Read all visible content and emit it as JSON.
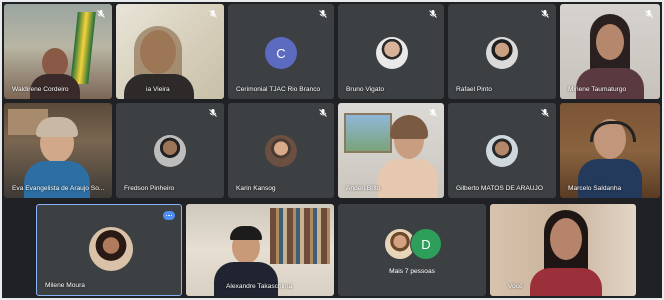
{
  "participants": [
    {
      "name": "Waldirene Cordeiro"
    },
    {
      "name": "ia Vieira"
    },
    {
      "name": "Cerimonial TJAC Rio Branco",
      "initial": "C"
    },
    {
      "name": "Bruno Vigato"
    },
    {
      "name": "Rafael Pinto"
    },
    {
      "name": "Miriene Taumaturgo"
    },
    {
      "name": "Eva Evangelista de Araujo So..."
    },
    {
      "name": "Fredson Pinheiro"
    },
    {
      "name": "Karin Kansog"
    },
    {
      "name": "Anderi Brito"
    },
    {
      "name": "Gilberto MATOS DE ARAUJO"
    },
    {
      "name": "Marcelo Saldanha"
    },
    {
      "name": "Milene Moura"
    },
    {
      "name": "Alexandre Takaschima"
    },
    {
      "name": "Mais 7 pessoas",
      "initial": "D"
    },
    {
      "name": "Você"
    }
  ],
  "colors": {
    "tile_bg": "#3c4043",
    "accent_blue": "#4f8ef7",
    "cerimonial_avatar": "#5c6bc0",
    "more_people_avatar": "#2e9e5b"
  },
  "icons": {
    "muted": "mic-off-icon",
    "pinned_menu": "more-options-icon"
  }
}
